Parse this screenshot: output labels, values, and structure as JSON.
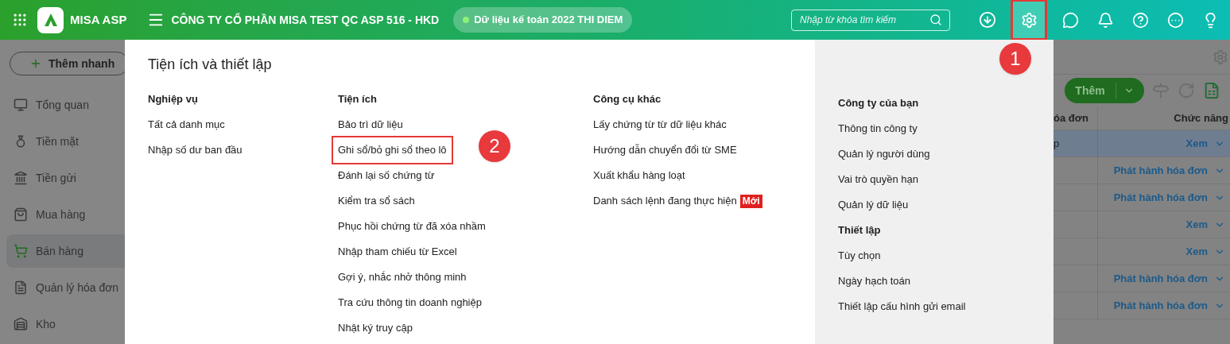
{
  "header": {
    "brand": "MISA ASP",
    "company": "CÔNG TY CỔ PHẦN MISA TEST QC ASP 516 - HKD",
    "data_status": "Dữ liệu kế toán 2022 THI DIEM",
    "search": {
      "placeholder": "Nhập từ khóa tìm kiếm"
    },
    "settings_highlighted": true
  },
  "sidebar": {
    "quick_add": "Thêm nhanh",
    "items": [
      {
        "label": "Tổng quan",
        "selected": false
      },
      {
        "label": "Tiền mặt",
        "selected": false
      },
      {
        "label": "Tiền gửi",
        "selected": false
      },
      {
        "label": "Mua hàng",
        "selected": false
      },
      {
        "label": "Bán hàng",
        "selected": true
      },
      {
        "label": "Quản lý hóa đơn",
        "selected": false
      },
      {
        "label": "Kho",
        "selected": false
      }
    ]
  },
  "menu": {
    "title": "Tiện ích và thiết lập",
    "columns": [
      {
        "sections": [
          {
            "heading": "Nghiệp vụ",
            "items": [
              {
                "label": "Tất cả danh mục",
                "highlighted": false
              },
              {
                "label": "Nhập số dư ban đầu",
                "highlighted": false
              }
            ]
          }
        ]
      },
      {
        "sections": [
          {
            "heading": "Tiện ích",
            "items": [
              {
                "label": "Bảo trì dữ liệu",
                "highlighted": false
              },
              {
                "label": "Ghi sổ/bỏ ghi sổ theo lô",
                "highlighted": true
              },
              {
                "label": "Đánh lại số chứng từ",
                "highlighted": false
              },
              {
                "label": "Kiểm tra sổ sách",
                "highlighted": false
              },
              {
                "label": "Phục hồi chứng từ đã xóa nhầm",
                "highlighted": false
              },
              {
                "label": "Nhập tham chiếu từ Excel",
                "highlighted": false
              },
              {
                "label": "Gợi ý, nhắc nhở thông minh",
                "highlighted": false
              },
              {
                "label": "Tra cứu thông tin doanh nghiệp",
                "highlighted": false
              },
              {
                "label": "Nhật ký truy cập",
                "highlighted": false
              }
            ]
          }
        ]
      },
      {
        "sections": [
          {
            "heading": "Công cụ khác",
            "items": [
              {
                "label": "Lấy chứng từ từ dữ liệu khác",
                "highlighted": false
              },
              {
                "label": "Hướng dẫn chuyển đổi từ SME",
                "highlighted": false
              },
              {
                "label": "Xuất khẩu hàng loạt",
                "highlighted": false
              },
              {
                "label": "Danh sách lệnh đang thực hiện",
                "highlighted": false,
                "badge": "Mới"
              }
            ]
          }
        ]
      },
      {
        "sections": [
          {
            "heading": "Công ty của bạn",
            "items": [
              {
                "label": "Thông tin công ty",
                "highlighted": false
              },
              {
                "label": "Quản lý người dùng",
                "highlighted": false
              },
              {
                "label": "Vai trò quyền hạn",
                "highlighted": false
              },
              {
                "label": "Quản lý dữ liệu",
                "highlighted": false
              }
            ]
          },
          {
            "heading": "Thiết lập",
            "items": [
              {
                "label": "Tùy chọn",
                "highlighted": false
              },
              {
                "label": "Ngày hạch toán",
                "highlighted": false
              },
              {
                "label": "Thiết lập cấu hình gửi email",
                "highlighted": false
              }
            ]
          }
        ]
      }
    ]
  },
  "table": {
    "add_button": "Thêm",
    "columns": [
      "óa đơn",
      "Chức năng"
    ],
    "rows": [
      {
        "column_1": "p",
        "action": "Xem",
        "selected": true
      },
      {
        "action": "Phát hành hóa đơn",
        "selected": false
      },
      {
        "action": "Phát hành hóa đơn",
        "selected": false
      },
      {
        "action": "Xem",
        "selected": false
      },
      {
        "action": "Xem",
        "selected": false
      },
      {
        "action": "Phát hành hóa đơn",
        "selected": false
      },
      {
        "action": "Phát hành hóa đơn",
        "selected": false
      }
    ]
  },
  "annotations": [
    {
      "label": "1"
    },
    {
      "label": "2"
    }
  ]
}
